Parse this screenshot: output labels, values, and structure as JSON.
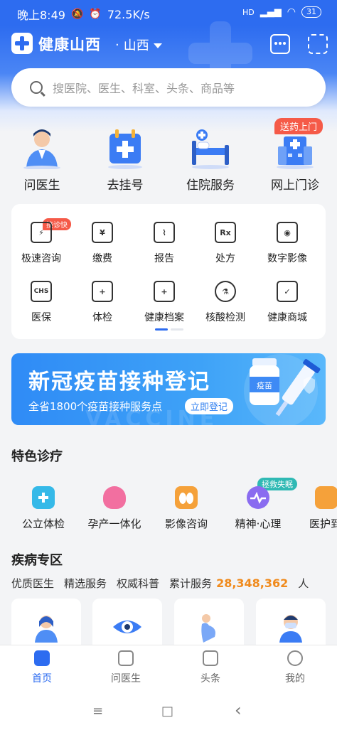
{
  "status_bar": {
    "time": "晚上8:49",
    "speed": "72.5K/s",
    "network": "HD",
    "battery": "31"
  },
  "header": {
    "app_name": "健康山西",
    "separator": "·",
    "region": "山西"
  },
  "search": {
    "placeholder": "搜医院、医生、科室、头条、商品等"
  },
  "top_services": [
    {
      "label": "问医生",
      "icon": "doctor-icon"
    },
    {
      "label": "去挂号",
      "icon": "register-icon"
    },
    {
      "label": "住院服务",
      "icon": "hospital-bed-icon"
    },
    {
      "label": "网上门诊",
      "icon": "building-icon"
    }
  ],
  "top_service_tag": "送药上门",
  "grid": [
    {
      "label": "极速咨询",
      "icon": "lightning-chat-icon",
      "glyph": "⚡"
    },
    {
      "label": "缴费",
      "icon": "payment-icon",
      "glyph": "¥"
    },
    {
      "label": "报告",
      "icon": "report-icon",
      "glyph": "⌇"
    },
    {
      "label": "处方",
      "icon": "prescription-icon",
      "glyph": "Rx"
    },
    {
      "label": "数字影像",
      "icon": "digital-image-icon",
      "glyph": "◉"
    },
    {
      "label": "医保",
      "icon": "insurance-icon",
      "glyph": "CHS"
    },
    {
      "label": "体检",
      "icon": "checkup-icon",
      "glyph": "+"
    },
    {
      "label": "健康档案",
      "icon": "health-record-icon",
      "glyph": "+"
    },
    {
      "label": "核酸检测",
      "icon": "test-tube-icon",
      "glyph": "⚗"
    },
    {
      "label": "健康商城",
      "icon": "shopping-bag-icon",
      "glyph": "✓"
    }
  ],
  "grid_tag": "接诊快",
  "banner": {
    "title": "新冠疫苗接种登记",
    "subtitle": "全省1800个疫苗接种服务点",
    "button": "立即登记",
    "faint_text": "VACCINE",
    "vial_label": "疫苗"
  },
  "featured": {
    "title": "特色诊疗",
    "items": [
      {
        "label": "公立体检",
        "color": "#35b9e8"
      },
      {
        "label": "孕产一体化",
        "color": "#f26fa0"
      },
      {
        "label": "影像咨询",
        "color": "#f5a13a"
      },
      {
        "label": "精神·心理",
        "color": "#8a6cf0"
      },
      {
        "label": "医护到",
        "color": "#f5a13a"
      }
    ],
    "tag": "拯救失眠"
  },
  "disease": {
    "title": "疾病专区",
    "stats": [
      "优质医生",
      "精选服务",
      "权威科普"
    ],
    "served_label": "累计服务",
    "served_count": "28,348,362",
    "served_unit": "人"
  },
  "tabs": [
    {
      "label": "首页"
    },
    {
      "label": "问医生"
    },
    {
      "label": "头条"
    },
    {
      "label": "我的"
    }
  ],
  "nav": {
    "menu": "≡",
    "home": "□",
    "back": "‹"
  },
  "colors": {
    "primary": "#2d6cf0",
    "accent_orange": "#f08a1c",
    "tag_red": "#f55a48"
  }
}
